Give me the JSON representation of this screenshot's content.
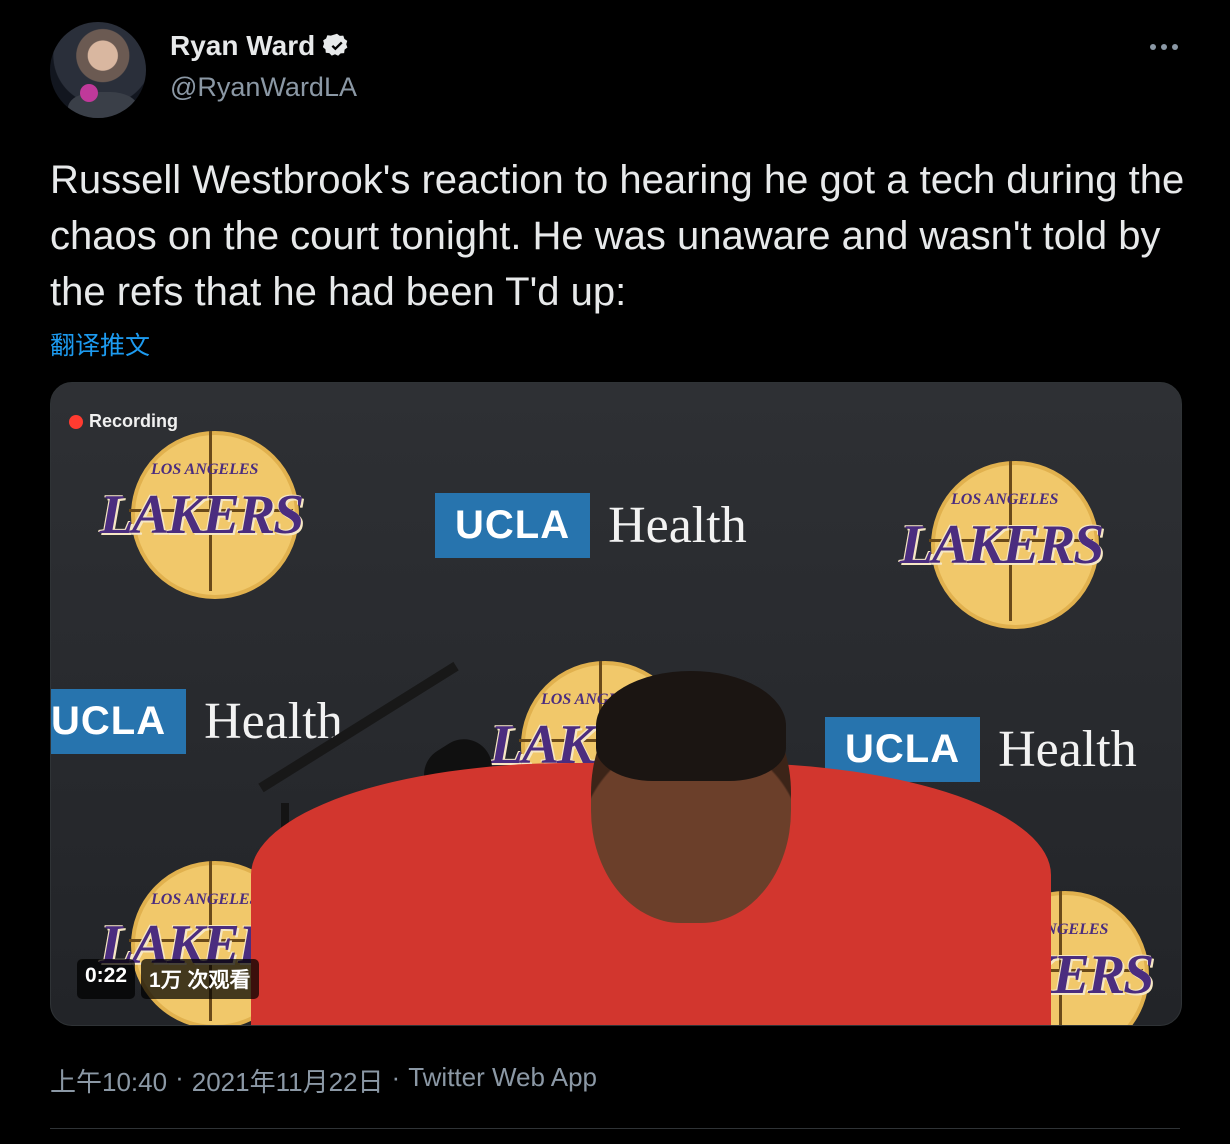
{
  "author": {
    "name": "Ryan Ward",
    "handle": "@RyanWardLA",
    "verified": true,
    "avatar_icon": "avatar-photo"
  },
  "tweet": {
    "text": "Russell Westbrook's reaction to hearing he got a tech during the chaos on the court tonight. He was unaware and wasn't told by the refs that he had been T'd up:",
    "translate_label": "翻译推文"
  },
  "media": {
    "recording_label": "Recording",
    "duration": "0:22",
    "views": "1万 次观看",
    "logos": {
      "lakers_word": "LAKERS",
      "lakers_small": "LOS ANGELES",
      "ucla": "UCLA",
      "health": "Health"
    }
  },
  "meta": {
    "time": "上午10:40",
    "date": "2021年11月22日",
    "source": "Twitter Web App",
    "separator": "·"
  },
  "colors": {
    "background": "#000000",
    "text": "#e7e9ea",
    "muted": "#8b98a5",
    "link": "#1d9bf0",
    "verified": "#e7e9ea"
  }
}
